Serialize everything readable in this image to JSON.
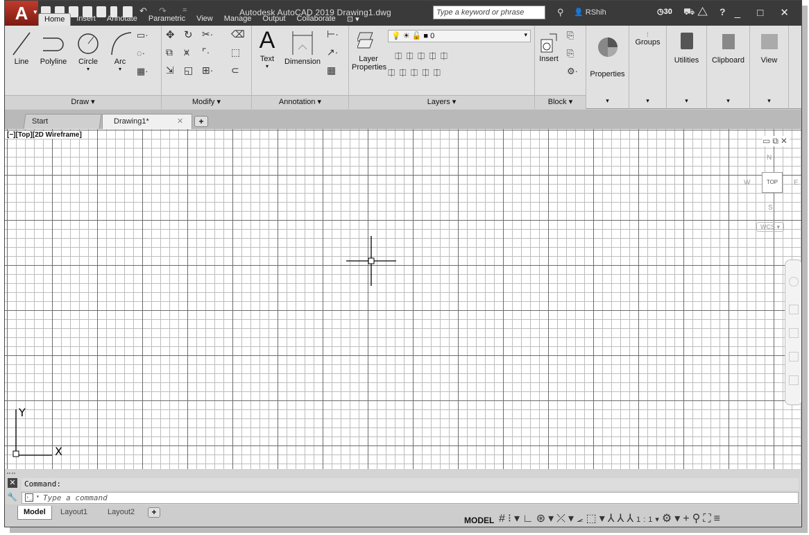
{
  "title_bar": {
    "app_logo": "A",
    "title": "Autodesk AutoCAD 2019   Drawing1.dwg",
    "search_placeholder": "Type a keyword or phrase",
    "user": "RShih",
    "clock_count": "30"
  },
  "ribbon_tabs": [
    "Home",
    "Insert",
    "Annotate",
    "Parametric",
    "View",
    "Manage",
    "Output",
    "Collaborate"
  ],
  "ribbon": {
    "draw": {
      "title": "Draw ▾",
      "line": "Line",
      "polyline": "Polyline",
      "circle": "Circle",
      "arc": "Arc"
    },
    "modify": {
      "title": "Modify ▾"
    },
    "annotation": {
      "title": "Annotation ▾",
      "text": "Text",
      "dimension": "Dimension"
    },
    "layers": {
      "title": "Layers ▾",
      "layer_properties_line1": "Layer",
      "layer_properties_line2": "Properties",
      "current_layer": "0"
    },
    "block": {
      "title": "Block ▾",
      "insert": "Insert"
    },
    "properties": "Properties",
    "groups": "Groups",
    "utilities": "Utilities",
    "clipboard": "Clipboard",
    "view": "View"
  },
  "doc_tabs": {
    "start": "Start",
    "drawing": "Drawing1*"
  },
  "viewport": {
    "label": "[−][Top][2D Wireframe]",
    "viewcube_top": "TOP",
    "compass_n": "N",
    "compass_w": "W",
    "compass_e": "E",
    "compass_s": "S",
    "wcs": "WCS",
    "ucs_x": "X",
    "ucs_y": "Y"
  },
  "command": {
    "history": "Command:",
    "placeholder": "Type a command"
  },
  "layout_tabs": [
    "Model",
    "Layout1",
    "Layout2"
  ],
  "status": {
    "model": "MODEL",
    "scale": "1:1"
  }
}
